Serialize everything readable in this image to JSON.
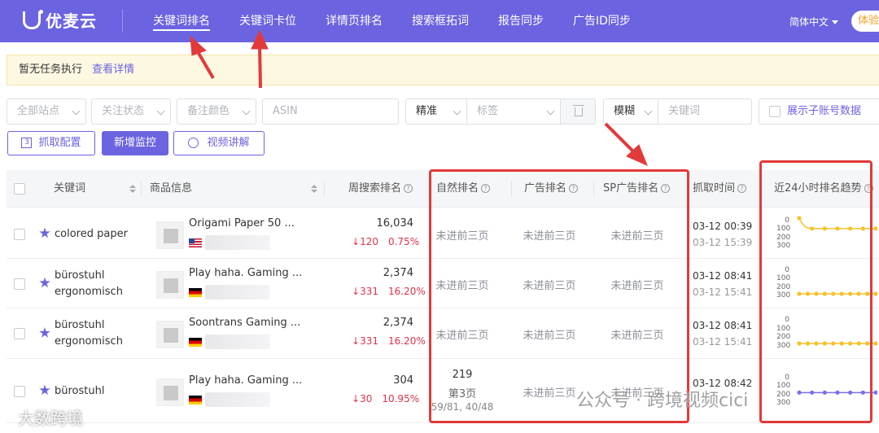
{
  "app": {
    "name": "优麦云"
  },
  "nav": {
    "items": [
      "关键词排名",
      "关键词卡位",
      "详情页排名",
      "搜索框拓词",
      "报告同步",
      "广告ID同步"
    ],
    "active_index": 0,
    "language": "简体中文",
    "trial_label": "体验"
  },
  "notice": {
    "text": "暂无任务执行",
    "link": "查看详情"
  },
  "filters": {
    "site": "全部站点",
    "follow_status": "关注状态",
    "note_color": "备注颜色",
    "asin_placeholder": "ASIN",
    "match_mode": "精准",
    "tag_placeholder": "标签",
    "fuzzy_mode": "模糊",
    "keyword_placeholder": "关键词",
    "show_sub_accounts": "展示子账号数据"
  },
  "toolbar": {
    "fetch_config_num": "3",
    "fetch_config": "抓取配置",
    "add_monitor": "新增监控",
    "video_tutorial": "视频讲解"
  },
  "table": {
    "headers": {
      "keyword": "关键词",
      "product": "商品信息",
      "weekly_search_rank": "周搜索排名",
      "organic_rank": "自然排名",
      "ad_rank": "广告排名",
      "sp_ad_rank": "SP广告排名",
      "fetch_time": "抓取时间",
      "trend_24h": "近24小时排名趋势"
    },
    "trend_axis": [
      "0",
      "100",
      "200",
      "300"
    ],
    "rows": [
      {
        "keyword_l1": "colored paper",
        "keyword_l2": "",
        "product_title": "Origami Paper 50 ...",
        "flag": "us",
        "search_rank": "16,034",
        "rank_delta": "120",
        "rank_pct": "0.75%",
        "organic_l1": "未进前三页",
        "organic_l2": "",
        "organic_l3": "",
        "ad": "未进前三页",
        "sp_ad": "未进前三页",
        "time1": "03-12 00:39",
        "time2": "03-12 15:39",
        "trend": [
          0,
          120,
          120,
          120,
          120,
          120,
          120
        ]
      },
      {
        "keyword_l1": "bürostuhl",
        "keyword_l2": "ergonomisch",
        "product_title": "Play haha. Gaming ...",
        "flag": "de",
        "search_rank": "2,374",
        "rank_delta": "331",
        "rank_pct": "16.20%",
        "organic_l1": "未进前三页",
        "organic_l2": "",
        "organic_l3": "",
        "ad": "未进前三页",
        "sp_ad": "未进前三页",
        "time1": "03-12 08:41",
        "time2": "03-12 15:41",
        "trend": [
          300,
          300,
          300,
          300,
          300,
          300,
          300,
          300,
          300,
          300
        ]
      },
      {
        "keyword_l1": "bürostuhl",
        "keyword_l2": "ergonomisch",
        "product_title": "Soontrans Gaming ...",
        "flag": "de",
        "search_rank": "2,374",
        "rank_delta": "331",
        "rank_pct": "16.20%",
        "organic_l1": "未进前三页",
        "organic_l2": "",
        "organic_l3": "",
        "ad": "未进前三页",
        "sp_ad": "未进前三页",
        "time1": "03-12 08:41",
        "time2": "03-12 15:41",
        "trend": [
          300,
          300,
          300,
          300,
          300,
          300,
          300,
          300,
          300,
          300
        ]
      },
      {
        "keyword_l1": "bürostuhl",
        "keyword_l2": "",
        "product_title": "Play haha. Gaming ...",
        "flag": "de",
        "search_rank": "304",
        "rank_delta": "30",
        "rank_pct": "10.95%",
        "organic_l1": "219",
        "organic_l2": "第3页",
        "organic_l3": "59/81, 40/48",
        "ad": "未进前三页",
        "sp_ad": "未进前三页",
        "time1": "03-12 08:42",
        "time2": "",
        "trend": [
          200,
          200,
          200,
          200,
          200,
          200,
          200
        ]
      }
    ]
  },
  "watermarks": {
    "left": "大数跨境",
    "right": "公众号 · 跨境视频cici"
  }
}
